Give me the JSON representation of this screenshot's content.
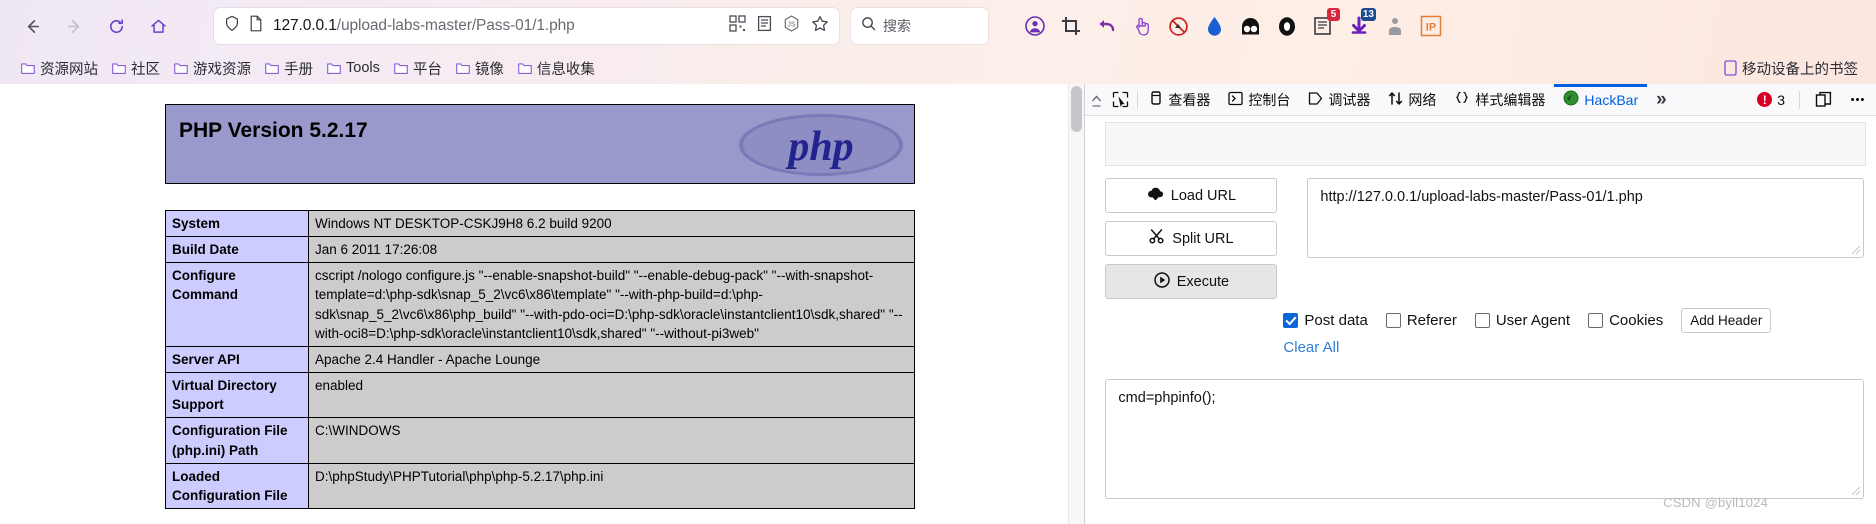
{
  "browser": {
    "nav": {
      "back": "back-arrow",
      "forward": "forward-arrow",
      "reload": "reload",
      "home": "home"
    },
    "url": {
      "host": "127.0.0.1",
      "path": "/upload-labs-master/Pass-01/1.php",
      "full": "127.0.0.1/upload-labs-master/Pass-01/1.php"
    },
    "search": {
      "placeholder": "搜索"
    },
    "extensions": [
      {
        "name": "user-account-icon",
        "badge": ""
      },
      {
        "name": "crop-screenshot-icon",
        "badge": ""
      },
      {
        "name": "undo-arrow-icon",
        "badge": ""
      },
      {
        "name": "pointer-hand-icon",
        "badge": ""
      },
      {
        "name": "block-script-icon",
        "badge": ""
      },
      {
        "name": "water-drop-icon",
        "badge": ""
      },
      {
        "name": "dark-reader-icon",
        "badge": ""
      },
      {
        "name": "ring-icon",
        "badge": ""
      },
      {
        "name": "notes-extension-icon",
        "badge": "5"
      },
      {
        "name": "download-arrow-icon",
        "badge": "13"
      },
      {
        "name": "proxy-switch-icon",
        "badge": ""
      },
      {
        "name": "ip-extension-icon",
        "badge": "IP"
      }
    ],
    "bookmarks": [
      "资源网站",
      "社区",
      "游戏资源",
      "手册",
      "Tools",
      "平台",
      "镜像",
      "信息收集"
    ],
    "bookmark_right": "移动设备上的书签"
  },
  "phpinfo": {
    "title": "PHP Version 5.2.17",
    "logo_text": "php",
    "rows": [
      {
        "key": "System",
        "value": "Windows NT DESKTOP-CSKJ9H8 6.2 build 9200"
      },
      {
        "key": "Build Date",
        "value": "Jan 6 2011 17:26:08"
      },
      {
        "key": "Configure Command",
        "value": "cscript /nologo configure.js \"--enable-snapshot-build\" \"--enable-debug-pack\" \"--with-snapshot-template=d:\\php-sdk\\snap_5_2\\vc6\\x86\\template\" \"--with-php-build=d:\\php-sdk\\snap_5_2\\vc6\\x86\\php_build\" \"--with-pdo-oci=D:\\php-sdk\\oracle\\instantclient10\\sdk,shared\" \"--with-oci8=D:\\php-sdk\\oracle\\instantclient10\\sdk,shared\" \"--without-pi3web\""
      },
      {
        "key": "Server API",
        "value": "Apache 2.4 Handler - Apache Lounge"
      },
      {
        "key": "Virtual Directory Support",
        "value": "enabled"
      },
      {
        "key": "Configuration File (php.ini) Path",
        "value": "C:\\WINDOWS"
      },
      {
        "key": "Loaded Configuration File",
        "value": "D:\\phpStudy\\PHPTutorial\\php\\php-5.2.17\\php.ini"
      }
    ]
  },
  "devtools": {
    "tabs": [
      {
        "label": "查看器",
        "icon": "inspector-icon",
        "active": false
      },
      {
        "label": "控制台",
        "icon": "console-icon",
        "active": false
      },
      {
        "label": "调试器",
        "icon": "debugger-icon",
        "active": false
      },
      {
        "label": "网络",
        "icon": "network-icon",
        "active": false
      },
      {
        "label": "样式编辑器",
        "icon": "style-editor-icon",
        "active": false
      },
      {
        "label": "HackBar",
        "icon": "hackbar-icon",
        "active": true
      }
    ],
    "overflow": "»",
    "error_count": "3",
    "dock_icon": "dock-panel-icon",
    "meatball_icon": "more-options-icon"
  },
  "hackbar": {
    "load_url": "Load URL",
    "split_url": "Split URL",
    "execute": "Execute",
    "url_value": "http://127.0.0.1/upload-labs-master/Pass-01/1.php",
    "options": [
      {
        "label": "Post data",
        "checked": true
      },
      {
        "label": "Referer",
        "checked": false
      },
      {
        "label": "User Agent",
        "checked": false
      },
      {
        "label": "Cookies",
        "checked": false
      }
    ],
    "add_header": "Add Header",
    "clear_all": "Clear All",
    "post_data": "cmd=phpinfo();"
  },
  "watermark": "CSDN @byll1024"
}
